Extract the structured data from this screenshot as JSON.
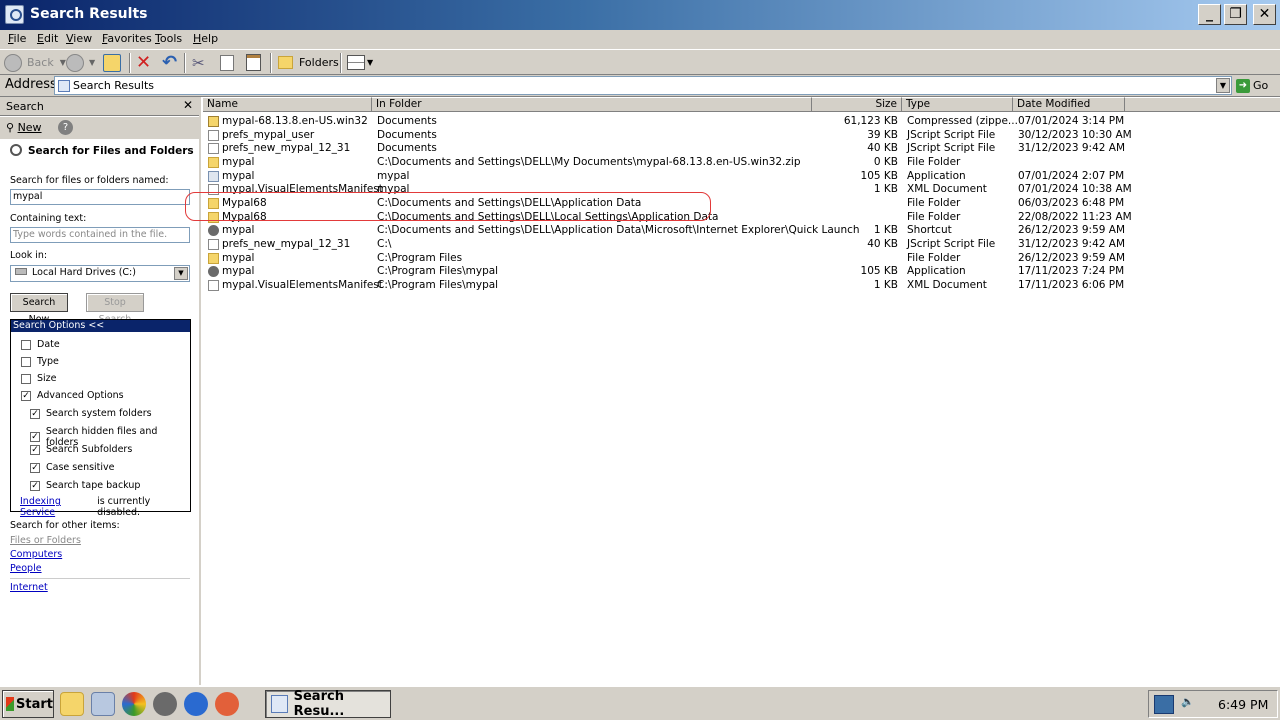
{
  "window": {
    "title": "Search Results",
    "minimize_icon": "minimize-icon",
    "maximize_icon": "restore-icon",
    "close_icon": "close-icon"
  },
  "menu": [
    "File",
    "Edit",
    "View",
    "Favorites",
    "Tools",
    "Help"
  ],
  "toolbar": {
    "back": "Back",
    "folders": "Folders"
  },
  "address": {
    "label": "Address",
    "value": "Search Results",
    "go": "Go"
  },
  "search_pane": {
    "title": "Search",
    "new_label": "New",
    "heading": "Search for Files and Folders",
    "named_label": "Search for files or folders named:",
    "named_value": "mypal",
    "containing_label": "Containing text:",
    "containing_placeholder": "Type words contained in the file.",
    "look_in_label": "Look in:",
    "look_in_value": "Local Hard Drives (C:)",
    "search_now": "Search Now",
    "stop_search": "Stop Search",
    "options_header": "Search Options  <<",
    "options": [
      {
        "label": "Date",
        "checked": false
      },
      {
        "label": "Type",
        "checked": false
      },
      {
        "label": "Size",
        "checked": false
      },
      {
        "label": "Advanced Options",
        "checked": true
      }
    ],
    "advanced": [
      {
        "label": "Search system folders",
        "checked": true
      },
      {
        "label": "Search hidden files and folders",
        "checked": true
      },
      {
        "label": "Search Subfolders",
        "checked": true
      },
      {
        "label": "Case sensitive",
        "checked": true
      },
      {
        "label": "Search tape backup",
        "checked": true
      }
    ],
    "indexing_link": "Indexing Service",
    "indexing_text": "is currently disabled.",
    "other_label": "Search for other items:",
    "other_links": [
      "Files or Folders",
      "Computers",
      "People"
    ],
    "internet": "Internet"
  },
  "columns": [
    "Name",
    "In Folder",
    "Size",
    "Type",
    "Date Modified"
  ],
  "rows": [
    {
      "icon": "zip",
      "name": "mypal-68.13.8.en-US.win32",
      "folder": "Documents",
      "size": "61,123 KB",
      "type": "Compressed (zippe...",
      "date": "07/01/2024 3:14 PM"
    },
    {
      "icon": "doc",
      "name": "prefs_mypal_user",
      "folder": "Documents",
      "size": "39 KB",
      "type": "JScript Script File",
      "date": "30/12/2023 10:30 AM"
    },
    {
      "icon": "doc",
      "name": "prefs_new_mypal_12_31",
      "folder": "Documents",
      "size": "40 KB",
      "type": "JScript Script File",
      "date": "31/12/2023 9:42 AM"
    },
    {
      "icon": "folder",
      "name": "mypal",
      "folder": "C:\\Documents and Settings\\DELL\\My Documents\\mypal-68.13.8.en-US.win32.zip",
      "size": "0 KB",
      "type": "File Folder",
      "date": ""
    },
    {
      "icon": "app",
      "name": "mypal",
      "folder": "mypal",
      "size": "105 KB",
      "type": "Application",
      "date": "07/01/2024 2:07 PM"
    },
    {
      "icon": "doc",
      "name": "mypal.VisualElementsManifest",
      "folder": "mypal",
      "size": "1 KB",
      "type": "XML Document",
      "date": "07/01/2024 10:38 AM"
    },
    {
      "icon": "folder",
      "name": "Mypal68",
      "folder": "C:\\Documents and Settings\\DELL\\Application Data",
      "size": "",
      "type": "File Folder",
      "date": "06/03/2023 6:48 PM"
    },
    {
      "icon": "folder",
      "name": "Mypal68",
      "folder": "C:\\Documents and Settings\\DELL\\Local Settings\\Application Data",
      "size": "",
      "type": "File Folder",
      "date": "22/08/2022 11:23 AM"
    },
    {
      "icon": "raccoon",
      "name": "mypal",
      "folder": "C:\\Documents and Settings\\DELL\\Application Data\\Microsoft\\Internet Explorer\\Quick Launch",
      "size": "1 KB",
      "type": "Shortcut",
      "date": "26/12/2023 9:59 AM"
    },
    {
      "icon": "doc",
      "name": "prefs_new_mypal_12_31",
      "folder": "C:\\",
      "size": "40 KB",
      "type": "JScript Script File",
      "date": "31/12/2023 9:42 AM"
    },
    {
      "icon": "folder",
      "name": "mypal",
      "folder": "C:\\Program Files",
      "size": "",
      "type": "File Folder",
      "date": "26/12/2023 9:59 AM"
    },
    {
      "icon": "raccoon",
      "name": "mypal",
      "folder": "C:\\Program Files\\mypal",
      "size": "105 KB",
      "type": "Application",
      "date": "17/11/2023 7:24 PM"
    },
    {
      "icon": "doc",
      "name": "mypal.VisualElementsManifest",
      "folder": "C:\\Program Files\\mypal",
      "size": "1 KB",
      "type": "XML Document",
      "date": "17/11/2023 6:06 PM"
    }
  ],
  "taskbar": {
    "start": "Start",
    "task": "Search Resu...",
    "clock": "6:49 PM"
  }
}
